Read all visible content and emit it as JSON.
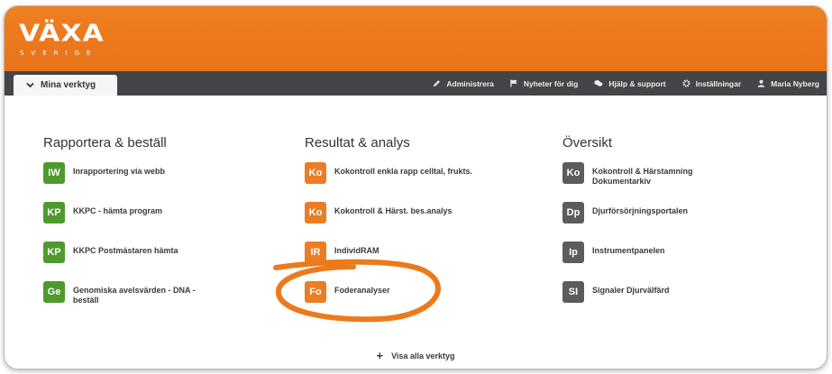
{
  "header": {
    "logo_main": "VÄXA",
    "logo_sub": "SVERIGE",
    "brand_color": "#e9731a"
  },
  "navbar": {
    "tab_label": "Mina verktyg",
    "items": [
      {
        "label": "Administrera",
        "icon": "pencil-icon"
      },
      {
        "label": "Nyheter för dig",
        "icon": "flag-icon"
      },
      {
        "label": "Hjälp & support",
        "icon": "chat-bubbles-icon"
      },
      {
        "label": "Inställningar",
        "icon": "gear-icon"
      },
      {
        "label": "Maria Nyberg",
        "icon": "user-icon"
      }
    ]
  },
  "columns": [
    {
      "title": "Rapportera & beställ",
      "color": "#4f9a2f",
      "tools": [
        {
          "badge": "IW",
          "label": "Inrapportering via webb"
        },
        {
          "badge": "KP",
          "label": "KKPC - hämta program"
        },
        {
          "badge": "KP",
          "label": "KKPC Postmästaren hämta"
        },
        {
          "badge": "Ge",
          "label": "Genomiska avelsvärden - DNA - beställ"
        }
      ]
    },
    {
      "title": "Resultat & analys",
      "color": "#eb7d24",
      "tools": [
        {
          "badge": "Ko",
          "label": "Kokontroll enkla rapp celltal, frukts."
        },
        {
          "badge": "Ko",
          "label": "Kokontroll & Härst. bes.analys"
        },
        {
          "badge": "IR",
          "label": "IndividRAM"
        },
        {
          "badge": "Fo",
          "label": "Foderanalyser"
        }
      ]
    },
    {
      "title": "Översikt",
      "color": "#5b5c5e",
      "tools": [
        {
          "badge": "Ko",
          "label": "Kokontroll & Härstamning Dokumentarkiv"
        },
        {
          "badge": "Dp",
          "label": "Djurförsörjningsportalen"
        },
        {
          "badge": "Ip",
          "label": "Instrumentpanelen"
        },
        {
          "badge": "SI",
          "label": "Signaler Djurvälfärd"
        }
      ]
    }
  ],
  "show_all_label": "Visa alla verktyg",
  "annotation_color": "#ec7a1c"
}
